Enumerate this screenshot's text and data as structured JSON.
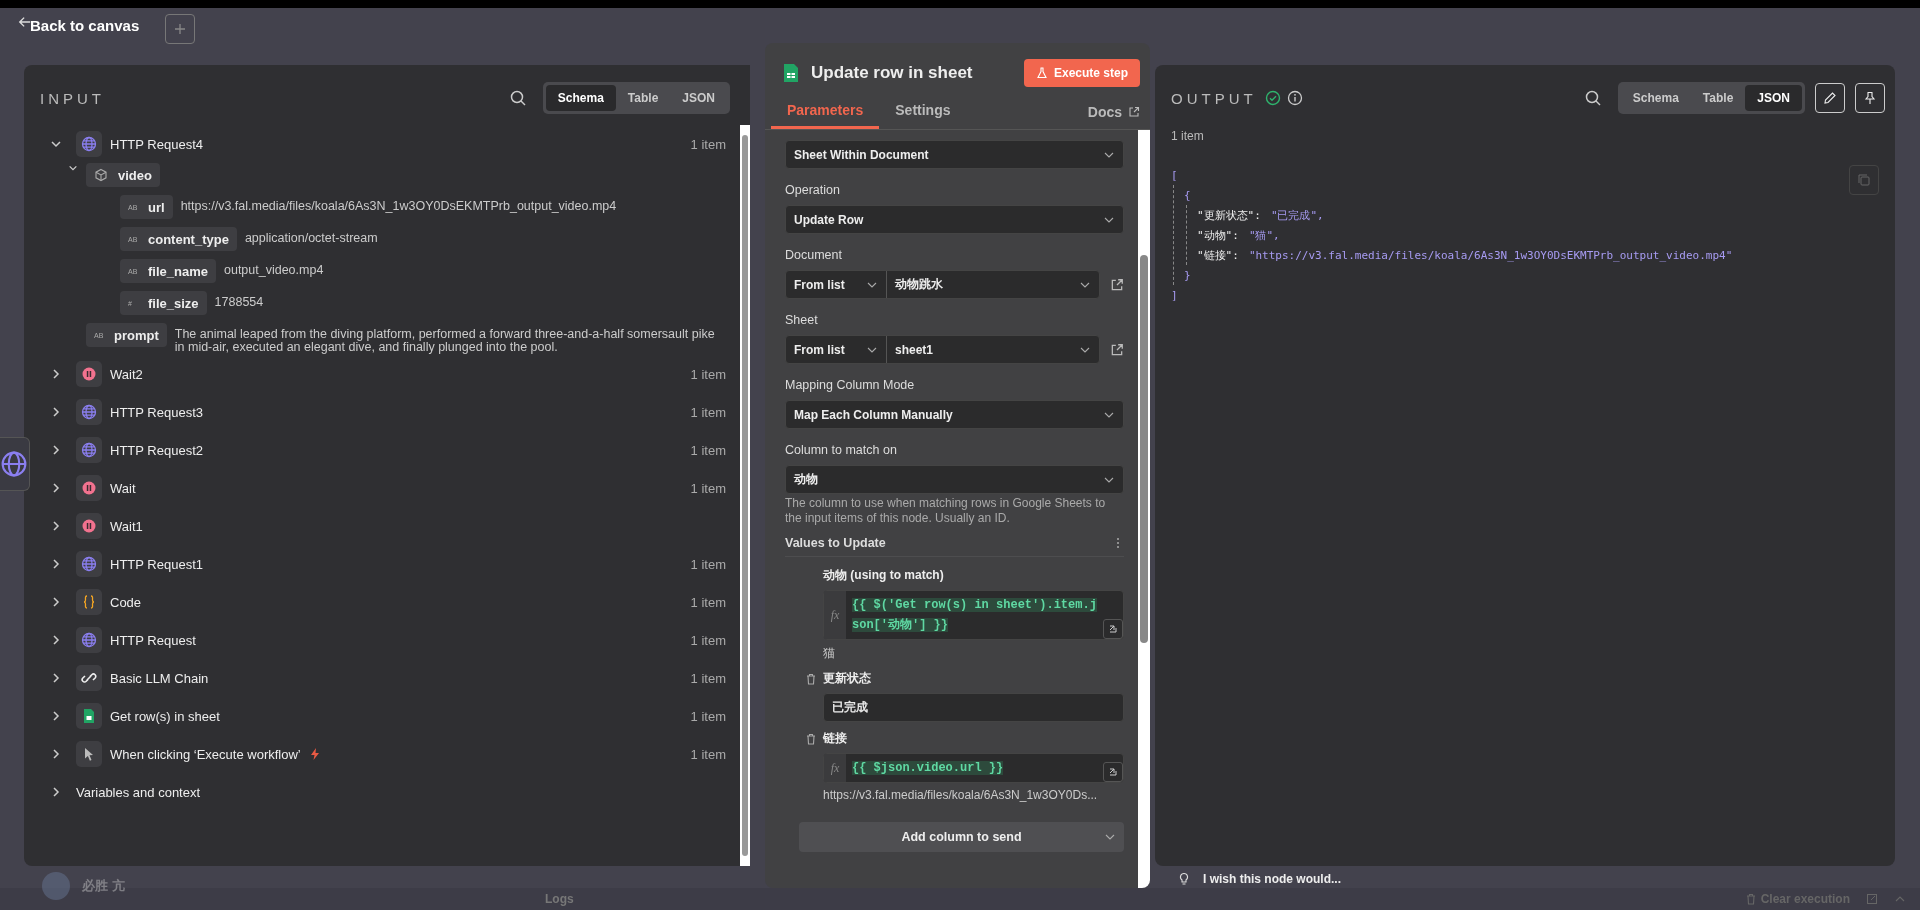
{
  "header": {
    "back_label": "Back to canvas"
  },
  "input": {
    "title": "INPUT",
    "views": [
      {
        "label": "Schema",
        "selected": true
      },
      {
        "label": "Table",
        "selected": false
      },
      {
        "label": "JSON",
        "selected": false
      }
    ],
    "nodes": [
      {
        "name": "HTTP Request4",
        "kind": "http",
        "count": "1 item",
        "expanded": true,
        "fields": [
          {
            "name": "video",
            "kind": "object",
            "expanded": true,
            "children": [
              {
                "name": "url",
                "glyph": "AB",
                "value": "https://v3.fal.media/files/koala/6As3N_1w3OY0DsEKMTPrb_output_video.mp4"
              },
              {
                "name": "content_type",
                "glyph": "AB",
                "value": "application/octet-stream"
              },
              {
                "name": "file_name",
                "glyph": "AB",
                "value": "output_video.mp4"
              },
              {
                "name": "file_size",
                "glyph": "#",
                "value": "1788554"
              }
            ]
          },
          {
            "name": "prompt",
            "kind": "value",
            "glyph": "AB",
            "value": "The animal leaped from the diving platform, performed a forward three-and-a-half somersault pike in mid-air, executed an elegant dive, and finally plunged into the pool."
          }
        ]
      },
      {
        "name": "Wait2",
        "kind": "wait",
        "count": "1 item",
        "expanded": false
      },
      {
        "name": "HTTP Request3",
        "kind": "http",
        "count": "1 item",
        "expanded": false
      },
      {
        "name": "HTTP Request2",
        "kind": "http",
        "count": "1 item",
        "expanded": false
      },
      {
        "name": "Wait",
        "kind": "wait",
        "count": "1 item",
        "expanded": false
      },
      {
        "name": "Wait1",
        "kind": "wait",
        "expanded": false
      },
      {
        "name": "HTTP Request1",
        "kind": "http",
        "count": "1 item",
        "expanded": false
      },
      {
        "name": "Code",
        "kind": "code",
        "count": "1 item",
        "expanded": false
      },
      {
        "name": "HTTP Request",
        "kind": "http",
        "count": "1 item",
        "expanded": false
      },
      {
        "name": "Basic LLM Chain",
        "kind": "chain",
        "count": "1 item",
        "expanded": false
      },
      {
        "name": "Get row(s) in sheet",
        "kind": "sheets",
        "count": "1 item",
        "expanded": false
      },
      {
        "name": "When clicking ‘Execute workflow’",
        "kind": "trigger",
        "count": "1 item",
        "expanded": false
      }
    ],
    "variables": {
      "label": "Variables and context",
      "expanded": false
    }
  },
  "node": {
    "title": "Update row in sheet",
    "execute_label": "Execute step",
    "tabs": [
      {
        "label": "Parameters",
        "selected": true
      },
      {
        "label": "Settings",
        "selected": false
      }
    ],
    "docs_label": "Docs",
    "parameters": [
      {
        "kind": "select",
        "value": "Sheet Within Document"
      },
      {
        "kind": "select",
        "label": "Operation",
        "value": "Update Row"
      },
      {
        "kind": "locator",
        "label": "Document",
        "mode": "From list",
        "value": "动物跳水"
      },
      {
        "kind": "locator",
        "label": "Sheet",
        "mode": "From list",
        "value": "sheet1"
      },
      {
        "kind": "select",
        "label": "Mapping Column Mode",
        "value": "Map Each Column Manually"
      },
      {
        "kind": "select",
        "label": "Column to match on",
        "value": "动物",
        "hint": "The column to use when matching rows in Google Sheets to the input items of this node. Usually an ID."
      }
    ],
    "values_title": "Values to Update",
    "columns": [
      {
        "label": "动物 (using to match)",
        "kind": "expression",
        "prefix": "fx",
        "value": "{{ $('Get row(s) in sheet').item.json['动物'] }}",
        "preview": "猫",
        "removable": false
      },
      {
        "label": "更新状态",
        "kind": "text",
        "value": "已完成",
        "removable": true
      },
      {
        "label": "链接",
        "kind": "expression",
        "prefix": "fx",
        "value": "{{ $json.video.url }}",
        "preview": "https://v3.fal.media/files/koala/6As3N_1w3OY0Ds...",
        "removable": true
      }
    ],
    "add_label": "Add column to send"
  },
  "output": {
    "title": "OUTPUT",
    "views": [
      {
        "label": "Schema",
        "selected": false
      },
      {
        "label": "Table",
        "selected": false
      },
      {
        "label": "JSON",
        "selected": true
      }
    ],
    "count": "1 item",
    "json": {
      "open": "[",
      "close": "]",
      "items": [
        {
          "open": "{",
          "close": "}",
          "pairs": [
            {
              "key": "\"更新状态\":",
              "value": "\"已完成\","
            },
            {
              "key": "\"动物\":",
              "value": "\"猫\","
            },
            {
              "key": "\"链接\":",
              "value": "\"https://v3.fal.media/files/koala/6As3N_1w3OY0DsEKMTPrb_output_video.mp4\""
            }
          ]
        }
      ]
    },
    "feedback": "I wish this node would..."
  },
  "backdrop": {
    "user_name": "必胜 亢",
    "logs_label": "Logs",
    "clear_label": "Clear execution"
  }
}
